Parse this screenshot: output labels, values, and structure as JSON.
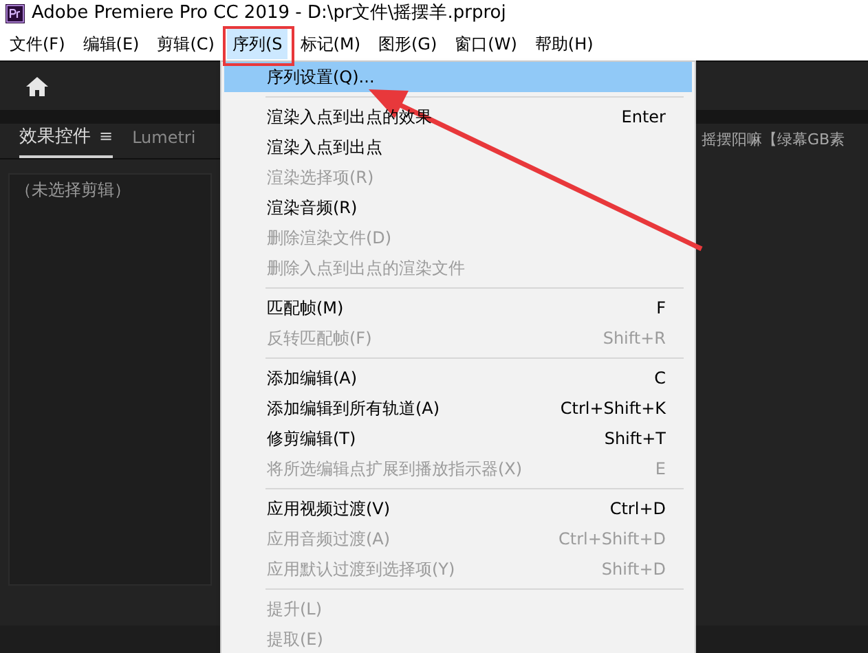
{
  "window": {
    "title": "Adobe Premiere Pro CC 2019 - D:\\pr文件\\摇摆羊.prproj"
  },
  "menu_bar": [
    {
      "label": "文件(F)",
      "selected": false
    },
    {
      "label": "编辑(E)",
      "selected": false
    },
    {
      "label": "剪辑(C)",
      "selected": false
    },
    {
      "label": "序列(S",
      "selected": true
    },
    {
      "label": "标记(M)",
      "selected": false
    },
    {
      "label": "图形(G)",
      "selected": false
    },
    {
      "label": "窗口(W)",
      "selected": false
    },
    {
      "label": "帮助(H)",
      "selected": false
    }
  ],
  "panel": {
    "tabs": [
      {
        "label": "效果控件",
        "selected": true,
        "menu_icon": "≡"
      },
      {
        "label": "Lumetri",
        "selected": false
      }
    ],
    "message": "（未选择剪辑）"
  },
  "right_panel": {
    "title": "摇摆阳嘛【绿幕GB素"
  },
  "dropdown": [
    {
      "kind": "item",
      "label": "序列设置(Q)...",
      "selected": true,
      "disabled": false
    },
    {
      "kind": "separator"
    },
    {
      "kind": "item",
      "label": "渲染入点到出点的效果",
      "shortcut": "Enter",
      "selected": false,
      "disabled": false
    },
    {
      "kind": "item",
      "label": "渲染入点到出点",
      "selected": false,
      "disabled": false
    },
    {
      "kind": "item",
      "label": "渲染选择项(R)",
      "selected": false,
      "disabled": true
    },
    {
      "kind": "item",
      "label": "渲染音频(R)",
      "selected": false,
      "disabled": false
    },
    {
      "kind": "item",
      "label": "删除渲染文件(D)",
      "selected": false,
      "disabled": true
    },
    {
      "kind": "item",
      "label": "删除入点到出点的渲染文件",
      "selected": false,
      "disabled": true
    },
    {
      "kind": "separator"
    },
    {
      "kind": "item",
      "label": "匹配帧(M)",
      "shortcut": "F",
      "selected": false,
      "disabled": false
    },
    {
      "kind": "item",
      "label": "反转匹配帧(F)",
      "shortcut": "Shift+R",
      "selected": false,
      "disabled": true
    },
    {
      "kind": "separator"
    },
    {
      "kind": "item",
      "label": "添加编辑(A)",
      "shortcut": "C",
      "selected": false,
      "disabled": false
    },
    {
      "kind": "item",
      "label": "添加编辑到所有轨道(A)",
      "shortcut": "Ctrl+Shift+K",
      "selected": false,
      "disabled": false
    },
    {
      "kind": "item",
      "label": "修剪编辑(T)",
      "shortcut": "Shift+T",
      "selected": false,
      "disabled": false
    },
    {
      "kind": "item",
      "label": "将所选编辑点扩展到播放指示器(X)",
      "shortcut": "E",
      "selected": false,
      "disabled": true
    },
    {
      "kind": "separator"
    },
    {
      "kind": "item",
      "label": "应用视频过渡(V)",
      "shortcut": "Ctrl+D",
      "selected": false,
      "disabled": false
    },
    {
      "kind": "item",
      "label": "应用音频过渡(A)",
      "shortcut": "Ctrl+Shift+D",
      "selected": false,
      "disabled": true
    },
    {
      "kind": "item",
      "label": "应用默认过渡到选择项(Y)",
      "shortcut": "Shift+D",
      "selected": false,
      "disabled": true
    },
    {
      "kind": "separator"
    },
    {
      "kind": "item",
      "label": "提升(L)",
      "selected": false,
      "disabled": true
    },
    {
      "kind": "item",
      "label": "提取(E)",
      "selected": false,
      "disabled": true
    }
  ]
}
